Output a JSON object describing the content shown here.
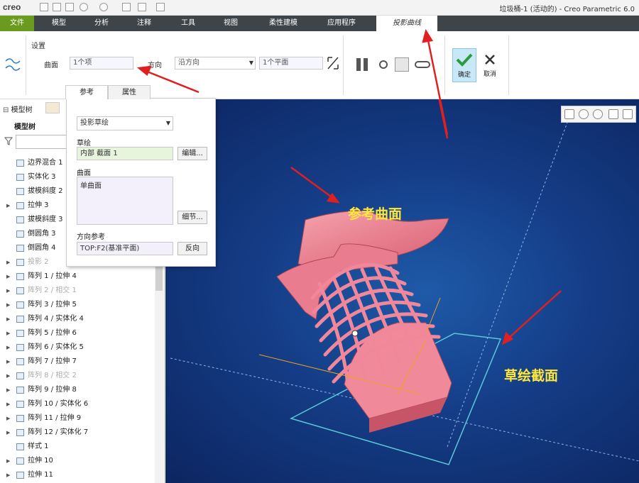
{
  "app": {
    "logo": "creo",
    "window_title": "垃圾桶-1 (活动的) - Creo Parametric 6.0"
  },
  "menubar": {
    "tabs": [
      "文件",
      "模型",
      "分析",
      "注释",
      "工具",
      "视图",
      "柔性建模",
      "应用程序"
    ],
    "active_tab": "投影曲线"
  },
  "ribbon": {
    "group_label": "设置",
    "surface_label": "曲面",
    "surface_value": "1个项",
    "direction_label": "方向",
    "direction_value": "沿方向",
    "plane_value": "1个平面",
    "ok_label": "确定",
    "cancel_label": "取消"
  },
  "sidebar": {
    "tab_label": "模型树",
    "tree_title": "模型树",
    "items": [
      {
        "label": "边界混合 1",
        "caret": false,
        "dim": false
      },
      {
        "label": "实体化 3",
        "caret": false,
        "dim": false
      },
      {
        "label": "拔模斜度 2",
        "caret": false,
        "dim": false
      },
      {
        "label": "拉伸 3",
        "caret": true,
        "dim": false
      },
      {
        "label": "拔模斜度 3",
        "caret": false,
        "dim": false
      },
      {
        "label": "倒圆角 3",
        "caret": false,
        "dim": false
      },
      {
        "label": "倒圆角 4",
        "caret": false,
        "dim": false
      },
      {
        "label": "投影 2",
        "caret": true,
        "dim": true
      },
      {
        "label": "阵列 1 / 拉伸 4",
        "caret": true,
        "dim": false
      },
      {
        "label": "阵列 2 / 相交 1",
        "caret": true,
        "dim": true
      },
      {
        "label": "阵列 3 / 拉伸 5",
        "caret": true,
        "dim": false
      },
      {
        "label": "阵列 4 / 实体化 4",
        "caret": true,
        "dim": false
      },
      {
        "label": "阵列 5 / 拉伸 6",
        "caret": true,
        "dim": false
      },
      {
        "label": "阵列 6 / 实体化 5",
        "caret": true,
        "dim": false
      },
      {
        "label": "阵列 7 / 拉伸 7",
        "caret": true,
        "dim": false
      },
      {
        "label": "阵列 8 / 相交 2",
        "caret": true,
        "dim": true
      },
      {
        "label": "阵列 9 / 拉伸 8",
        "caret": true,
        "dim": false
      },
      {
        "label": "阵列 10 / 实体化 6",
        "caret": true,
        "dim": false
      },
      {
        "label": "阵列 11 / 拉伸 9",
        "caret": true,
        "dim": false
      },
      {
        "label": "阵列 12 / 实体化 7",
        "caret": true,
        "dim": false
      },
      {
        "label": "样式 1",
        "caret": false,
        "dim": false
      },
      {
        "label": "拉伸 10",
        "caret": true,
        "dim": false
      },
      {
        "label": "拉伸 11",
        "caret": true,
        "dim": false
      }
    ]
  },
  "panel": {
    "tab_reference": "参考",
    "tab_properties": "属性",
    "type_value": "投影草绘",
    "sketch_label": "草绘",
    "sketch_value": "内部 截面 1",
    "edit_button": "编辑...",
    "surface_label": "曲面",
    "surface_item": "单曲面",
    "details_button": "细节...",
    "dirref_label": "方向参考",
    "dirref_value": "TOP:F2(基准平面)",
    "reverse_button": "反向"
  },
  "annotations": {
    "ref_surface": "参考曲面",
    "sketch_section": "草绘截面"
  },
  "colors": {
    "accent_green": "#6a9b1f",
    "viewport_blue": "#153d87",
    "model_pink": "#ee7f91",
    "annotation_yellow": "#ffe83a",
    "arrow_red": "#e02020"
  }
}
